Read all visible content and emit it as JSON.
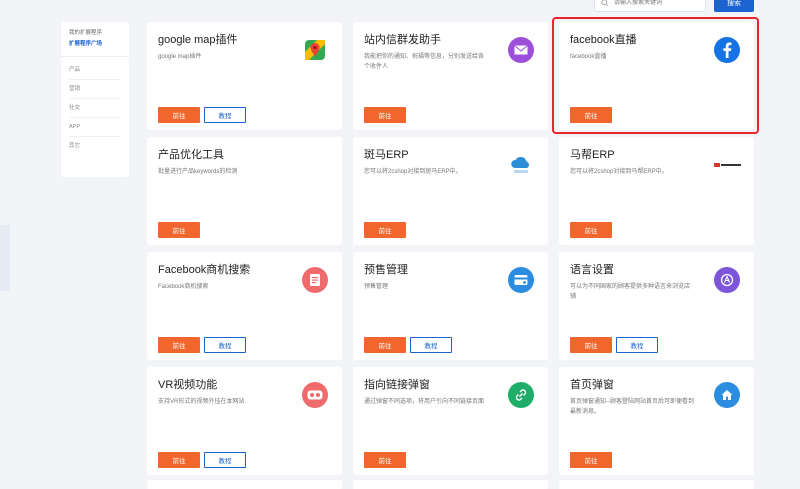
{
  "search": {
    "placeholder": "请输入搜索关键词",
    "button": "搜索"
  },
  "sidebar": {
    "top": [
      "我的扩展程序",
      "扩展程序广场"
    ],
    "categories": [
      "产品",
      "营销",
      "社交",
      "APP",
      "其它"
    ]
  },
  "buttons": {
    "go": "前往",
    "tutorial": "教程"
  },
  "cards": [
    {
      "title": "google map插件",
      "desc": "google map插件",
      "icon": "google-maps-icon",
      "tutorial": true
    },
    {
      "title": "站内信群发助手",
      "desc": "我能把你的通知、祝福等信息，分别发送给各个收件人",
      "icon": "mail-icon",
      "tutorial": false
    },
    {
      "title": "facebook直播",
      "desc": "facebook直播",
      "icon": "facebook-icon",
      "tutorial": false,
      "highlighted": true
    },
    {
      "title": "产品优化工具",
      "desc": "批量进行产品keywords的检测",
      "icon": "",
      "tutorial": false
    },
    {
      "title": "斑马ERP",
      "desc": "您可以将2cshop对接到斑马ERP中。",
      "icon": "cloud-icon",
      "tutorial": false
    },
    {
      "title": "马帮ERP",
      "desc": "您可以将2cshop对接到马帮ERP中。",
      "icon": "mabang-logo",
      "tutorial": false
    },
    {
      "title": "Facebook商机搜索",
      "desc": "Facebook商机搜索",
      "icon": "document-icon",
      "tutorial": true
    },
    {
      "title": "预售管理",
      "desc": "预售管理",
      "icon": "presale-icon",
      "tutorial": true
    },
    {
      "title": "语言设置",
      "desc": "可以为不同国家的顾客提供多种语言来浏览店铺",
      "icon": "language-icon",
      "tutorial": true
    },
    {
      "title": "VR视频功能",
      "desc": "支持VR形式的视频外挂在本网站",
      "icon": "vr-icon",
      "tutorial": true
    },
    {
      "title": "指向链接弹窗",
      "desc": "通过弹窗不同选项，将用户引向不同链接页面",
      "icon": "link-icon",
      "tutorial": false
    },
    {
      "title": "首页弹窗",
      "desc": "首页弹窗通知--顾客登陆网站首页后可即便看到最新消息。",
      "icon": "home-icon",
      "tutorial": false
    }
  ],
  "colors": {
    "accent": "#f0662c",
    "primary": "#1a63d0",
    "highlight": "#e8262d"
  }
}
